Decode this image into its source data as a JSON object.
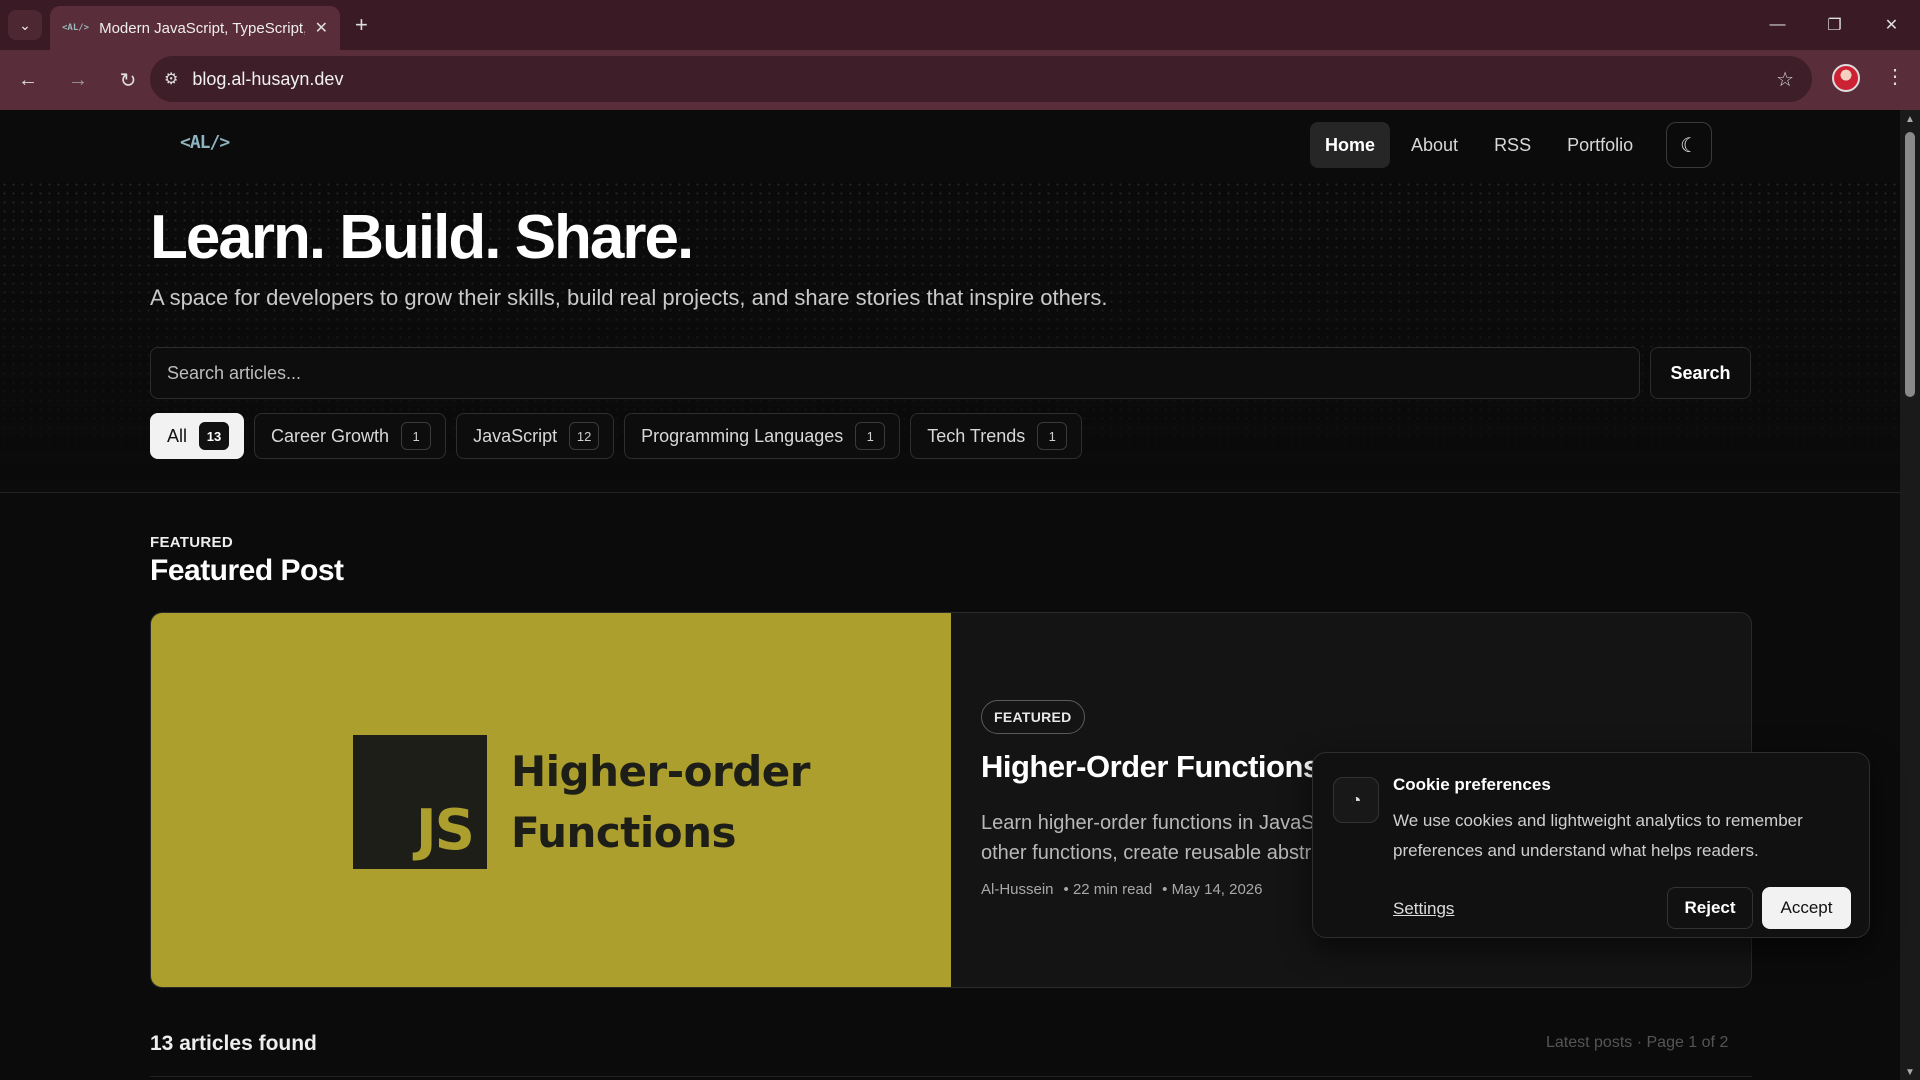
{
  "browser": {
    "tab_title": "Modern JavaScript, TypeScript, |",
    "tab_favicon": "<AL/>",
    "url": "blog.al-husayn.dev"
  },
  "site": {
    "logo": "<AL/>",
    "nav": [
      {
        "label": "Home",
        "active": true
      },
      {
        "label": "About",
        "active": false
      },
      {
        "label": "RSS",
        "active": false
      },
      {
        "label": "Portfolio",
        "active": false
      }
    ],
    "theme_icon": "moon-icon"
  },
  "hero": {
    "title": "Learn. Build. Share.",
    "subtitle": "A space for developers to grow their skills, build real projects, and share stories that inspire others.",
    "search_placeholder": "Search articles...",
    "search_button": "Search"
  },
  "categories": [
    {
      "label": "All",
      "count": "13",
      "active": true
    },
    {
      "label": "Career Growth",
      "count": "1",
      "active": false
    },
    {
      "label": "JavaScript",
      "count": "12",
      "active": false
    },
    {
      "label": "Programming Languages",
      "count": "1",
      "active": false
    },
    {
      "label": "Tech Trends",
      "count": "1",
      "active": false
    }
  ],
  "featured": {
    "kicker": "FEATURED",
    "section_title": "Featured Post",
    "image_logo": "JS",
    "image_title_line1": "Higher-order",
    "image_title_line2": "Functions",
    "badge": "FEATURED",
    "title": "Higher-Order Functions",
    "description": "Learn higher-order functions in JavaScript. Understand functions that accept or return other functions, create reusable abstractions, and write cleaner code.",
    "author": "Al-Hussein",
    "read_time": "• 22 min read",
    "date": "• May 14, 2026",
    "image_color": "#ad9f2e"
  },
  "listing": {
    "count_text": "13 articles found",
    "right_text": "Latest posts · Page 1 of 2"
  },
  "cookie": {
    "title": "Cookie preferences",
    "text": "We use cookies and lightweight analytics to remember preferences and understand what helps readers.",
    "settings": "Settings",
    "reject": "Reject",
    "accept": "Accept"
  }
}
